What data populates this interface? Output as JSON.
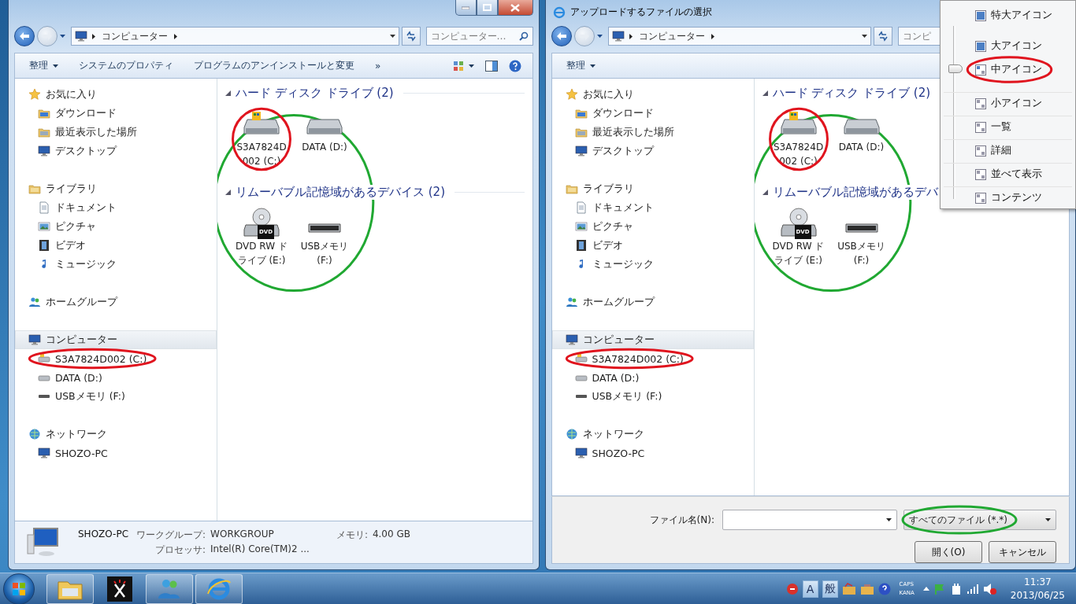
{
  "explorer": {
    "caption_buttons": true,
    "history": [
      {
        "kind": "back",
        "enabled": true
      },
      {
        "kind": "forward",
        "enabled": false
      }
    ],
    "address": {
      "crumbs": [
        "コンピューター"
      ]
    },
    "search": {
      "placeholder": "コンピューター…"
    },
    "toolbar": [
      {
        "label": "整理",
        "menu": true
      },
      {
        "label": "システムのプロパティ",
        "menu": false
      },
      {
        "label": "プログラムのアンインストールと変更",
        "menu": false
      },
      {
        "label": "»",
        "menu": false
      }
    ],
    "tool_icons": true,
    "nav": [
      {
        "label": "お気に入り",
        "kind": "star",
        "selected": false,
        "children": [
          {
            "label": "ダウンロード",
            "kind": "download",
            "selected": false
          },
          {
            "label": "最近表示した場所",
            "kind": "recent",
            "selected": false
          },
          {
            "label": "デスクトップ",
            "kind": "desktop",
            "selected": false
          }
        ]
      },
      {
        "label": "ライブラリ",
        "kind": "library",
        "selected": false,
        "children": [
          {
            "label": "ドキュメント",
            "kind": "document",
            "selected": false
          },
          {
            "label": "ピクチャ",
            "kind": "picture",
            "selected": false
          },
          {
            "label": "ビデオ",
            "kind": "video",
            "selected": false
          },
          {
            "label": "ミュージック",
            "kind": "music",
            "selected": false
          }
        ]
      },
      {
        "label": "ホームグループ",
        "kind": "homegroup",
        "selected": false
      },
      {
        "label": "コンピューター",
        "kind": "computer",
        "selected": true,
        "children": [
          {
            "label": "S3A7824D002 (C:)",
            "kind": "system-drive",
            "selected": false,
            "annotation": {
              "color": "#e0141e"
            }
          },
          {
            "label": "DATA (D:)",
            "kind": "drive",
            "selected": false
          },
          {
            "label": "USBメモリ (F:)",
            "kind": "usb",
            "selected": false
          }
        ]
      },
      {
        "label": "ネットワーク",
        "kind": "network",
        "selected": false,
        "children": [
          {
            "label": "SHOZO-PC",
            "kind": "pc",
            "selected": false
          }
        ]
      }
    ],
    "content": {
      "annotation": {
        "color": "#20a832"
      },
      "groups": [
        {
          "title": "ハード ディスク ドライブ (2)",
          "items": [
            {
              "label": "S3A7824D002 (C:)",
              "kind": "system-drive",
              "annotation": {
                "color": "#e0141e"
              }
            },
            {
              "label": "DATA (D:)",
              "kind": "drive"
            }
          ]
        },
        {
          "title": "リムーバブル記憶域があるデバイス (2)",
          "items": [
            {
              "label": "DVD RW ドライブ (E:)",
              "kind": "dvd",
              "badge": "DVD"
            },
            {
              "label": "USBメモリ (F:)",
              "kind": "usb"
            }
          ]
        }
      ]
    },
    "details": {
      "name": "SHOZO-PC",
      "fields": [
        {
          "label": "ワークグループ:",
          "value": "WORKGROUP"
        },
        {
          "label": "メモリ:",
          "value": "4.00 GB"
        },
        {
          "label": "プロセッサ:",
          "value": "Intel(R) Core(TM)2 ..."
        }
      ]
    }
  },
  "dialog": {
    "title": "アップロードするファイルの選択",
    "history": [
      {
        "kind": "back",
        "enabled": true
      },
      {
        "kind": "forward",
        "enabled": false
      }
    ],
    "address": {
      "crumbs": [
        "コンピューター"
      ]
    },
    "search": {
      "placeholder": "コンピ"
    },
    "toolbar": [
      {
        "label": "整理",
        "menu": true
      }
    ],
    "nav": [
      {
        "label": "お気に入り",
        "kind": "star",
        "selected": false,
        "children": [
          {
            "label": "ダウンロード",
            "kind": "download",
            "selected": false
          },
          {
            "label": "最近表示した場所",
            "kind": "recent",
            "selected": false
          },
          {
            "label": "デスクトップ",
            "kind": "desktop",
            "selected": false
          }
        ]
      },
      {
        "label": "ライブラリ",
        "kind": "library",
        "selected": false,
        "children": [
          {
            "label": "ドキュメント",
            "kind": "document",
            "selected": false
          },
          {
            "label": "ピクチャ",
            "kind": "picture",
            "selected": false
          },
          {
            "label": "ビデオ",
            "kind": "video",
            "selected": false
          },
          {
            "label": "ミュージック",
            "kind": "music",
            "selected": false
          }
        ]
      },
      {
        "label": "ホームグループ",
        "kind": "homegroup",
        "selected": false
      },
      {
        "label": "コンピューター",
        "kind": "computer",
        "selected": true,
        "children": [
          {
            "label": "S3A7824D002 (C:)",
            "kind": "system-drive",
            "selected": false,
            "annotation": {
              "color": "#e0141e"
            }
          },
          {
            "label": "DATA (D:)",
            "kind": "drive",
            "selected": false
          },
          {
            "label": "USBメモリ (F:)",
            "kind": "usb",
            "selected": false
          }
        ]
      },
      {
        "label": "ネットワーク",
        "kind": "network",
        "selected": false,
        "children": [
          {
            "label": "SHOZO-PC",
            "kind": "pc",
            "selected": false
          }
        ]
      }
    ],
    "content": {
      "annotation": {
        "color": "#20a832"
      },
      "groups": [
        {
          "title": "ハード ディスク ドライブ (2)",
          "items": [
            {
              "label": "S3A7824D002 (C:)",
              "kind": "system-drive",
              "annotation": {
                "color": "#e0141e"
              }
            },
            {
              "label": "DATA (D:)",
              "kind": "drive"
            }
          ]
        },
        {
          "title": "リムーバブル記憶域があるデバ",
          "items": [
            {
              "label": "DVD RW ドライブ (E:)",
              "kind": "dvd",
              "badge": "DVD"
            },
            {
              "label": "USBメモリ (F:)",
              "kind": "usb"
            }
          ]
        }
      ]
    },
    "file_name": {
      "label": "ファイル名(N):"
    },
    "file_type": {
      "value": "すべてのファイル (*.*)",
      "annotation": {
        "color": "#20a832"
      }
    },
    "buttons": [
      "開く(O)",
      "キャンセル"
    ]
  },
  "view_menu": {
    "items": [
      {
        "label": "特大アイコン",
        "selected": false
      },
      {
        "label": "大アイコン",
        "selected": false
      },
      {
        "label": "中アイコン",
        "selected": true,
        "annotation": {
          "color": "#e0141e"
        }
      },
      {
        "label": "小アイコン",
        "selected": false
      },
      {
        "label": "一覧",
        "selected": false
      },
      {
        "label": "詳細",
        "selected": false
      },
      {
        "label": "並べて表示",
        "selected": false
      },
      {
        "label": "コンテンツ",
        "selected": false
      }
    ]
  },
  "taskbar": {
    "apps": [
      {
        "kind": "folder",
        "running": true
      },
      {
        "kind": "scissors",
        "running": false
      },
      {
        "kind": "messenger",
        "running": true
      },
      {
        "kind": "browser",
        "running": true
      }
    ],
    "ime": [
      "A",
      "般"
    ],
    "caps": "CAPS",
    "kana": "KANA",
    "time": "11:37",
    "date": "2013/06/25"
  }
}
